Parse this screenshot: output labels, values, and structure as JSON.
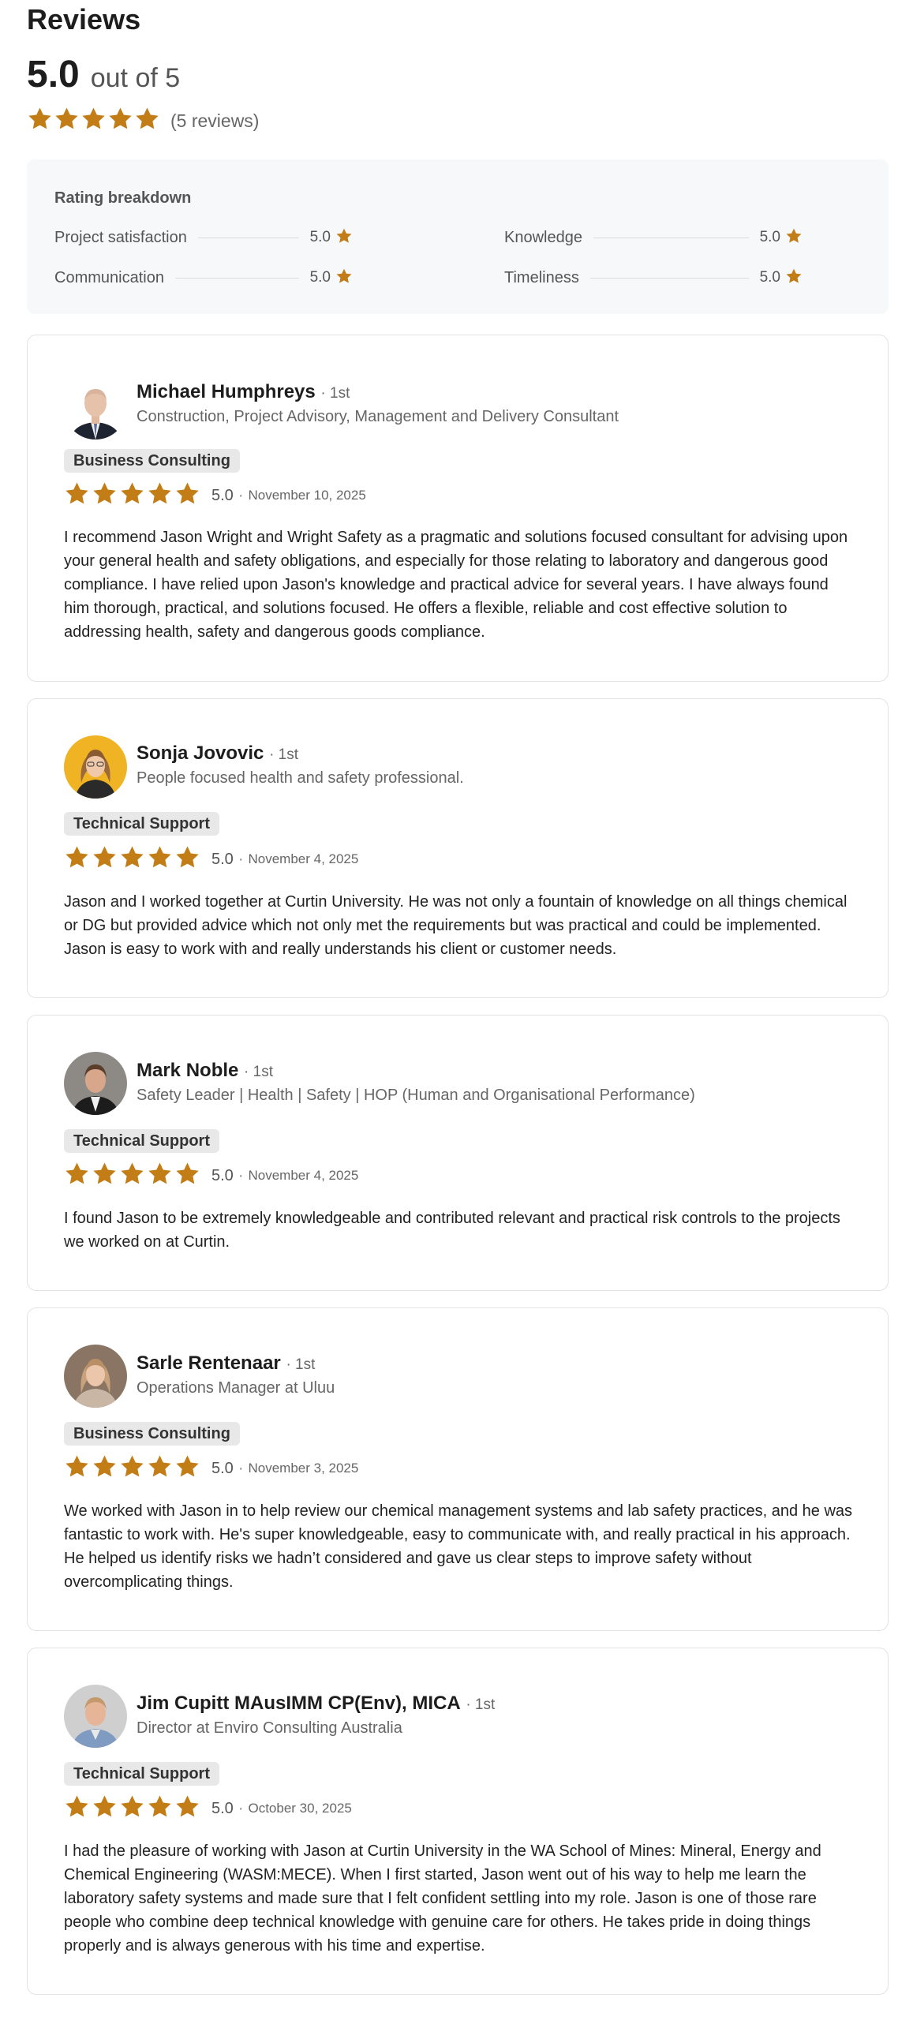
{
  "title": "Reviews",
  "overall": {
    "score": "5.0",
    "out_of": "out of 5",
    "count": "(5 reviews)",
    "stars": 5
  },
  "breakdown": {
    "title": "Rating breakdown",
    "items": [
      {
        "label": "Project satisfaction",
        "value": "5.0"
      },
      {
        "label": "Knowledge",
        "value": "5.0"
      },
      {
        "label": "Communication",
        "value": "5.0"
      },
      {
        "label": "Timeliness",
        "value": "5.0"
      }
    ]
  },
  "colors": {
    "star": "#c37d16",
    "tag_bg": "#e8e8e8",
    "panel_bg": "#f6f8f9"
  },
  "reviews": [
    {
      "name": "Michael Humphreys",
      "degree": "· 1st",
      "headline": "Construction, Project Advisory, Management and Delivery Consultant",
      "tag": "Business Consulting",
      "score": "5.0",
      "date": "November 10, 2025",
      "text": "I recommend Jason Wright and Wright Safety as a pragmatic and solutions focused consultant for advising upon your general health and safety obligations, and especially for those relating to laboratory and dangerous good compliance. I have relied upon Jason's knowledge and practical advice for several years. I have always found him thorough, practical, and solutions focused. He offers a flexible, reliable and cost effective solution to addressing health, safety and dangerous goods compliance."
    },
    {
      "name": "Sonja Jovovic",
      "degree": "· 1st",
      "headline": "People focused health and safety professional.",
      "tag": "Technical Support",
      "score": "5.0",
      "date": "November 4, 2025",
      "text": "Jason and I worked together at Curtin University. He was not only a fountain of knowledge on all things chemical or DG but provided advice which not only met the requirements but was practical and could be implemented. Jason is easy to work with and really understands his client or customer needs."
    },
    {
      "name": "Mark Noble",
      "degree": "· 1st",
      "headline": "Safety Leader | Health | Safety | HOP (Human and Organisational Performance)",
      "tag": "Technical Support",
      "score": "5.0",
      "date": "November 4, 2025",
      "text": "I found Jason to be extremely knowledgeable and contributed relevant and practical risk controls to the projects we worked on at Curtin."
    },
    {
      "name": "Sarle Rentenaar",
      "degree": "· 1st",
      "headline": "Operations Manager at Uluu",
      "tag": "Business Consulting",
      "score": "5.0",
      "date": "November 3, 2025",
      "text": "We worked with Jason in to help review our chemical management systems and lab safety practices, and he was fantastic to work with. He's super knowledgeable, easy to communicate with, and really practical in his approach. He helped us identify risks we hadn’t considered and gave us clear steps to improve safety without overcomplicating things."
    },
    {
      "name": "Jim Cupitt MAusIMM CP(Env), MICA",
      "degree": "· 1st",
      "headline": "Director at Enviro Consulting Australia",
      "tag": "Technical Support",
      "score": "5.0",
      "date": "October 30, 2025",
      "text": "I had the pleasure of working with Jason at Curtin University in the WA School of Mines: Mineral, Energy and Chemical Engineering (WASM:MECE). When I first started, Jason went out of his way to help me learn the laboratory safety systems and made sure that I felt confident settling into my role. Jason is one of those rare people who combine deep technical knowledge with genuine care for others. He takes pride in doing things properly and is always generous with his time and expertise."
    }
  ]
}
